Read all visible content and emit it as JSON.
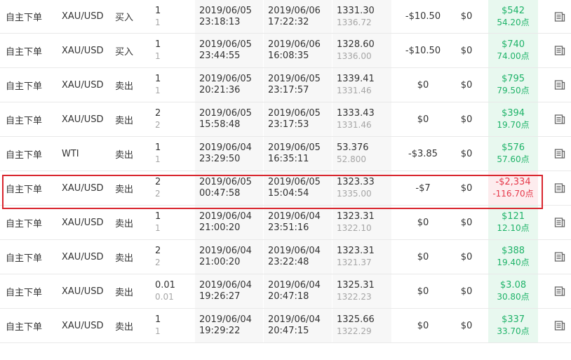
{
  "colors": {
    "profit": "#1fb369",
    "loss": "#e6394b",
    "profit_bg": "#e8f8ef",
    "loss_bg": "#fdecee",
    "highlight_border": "#d9262e"
  },
  "icon_name": "document-detail-icon",
  "rows": [
    {
      "type": "自主下单",
      "symbol": "XAU/USD",
      "direction": "买入",
      "lots": "1",
      "lots_closed": "1",
      "open_date": "2019/06/05",
      "open_time": "23:18:13",
      "close_date": "2019/06/06",
      "close_time": "17:22:32",
      "open_price": "1331.30",
      "close_price": "1336.72",
      "commission": "-$10.50",
      "swap": "$0",
      "profit": "$542",
      "points": "54.20点",
      "loss": false
    },
    {
      "type": "自主下单",
      "symbol": "XAU/USD",
      "direction": "买入",
      "lots": "1",
      "lots_closed": "1",
      "open_date": "2019/06/05",
      "open_time": "23:44:55",
      "close_date": "2019/06/06",
      "close_time": "16:08:35",
      "open_price": "1328.60",
      "close_price": "1336.00",
      "commission": "-$10.50",
      "swap": "$0",
      "profit": "$740",
      "points": "74.00点",
      "loss": false
    },
    {
      "type": "自主下单",
      "symbol": "XAU/USD",
      "direction": "卖出",
      "lots": "1",
      "lots_closed": "1",
      "open_date": "2019/06/05",
      "open_time": "20:21:36",
      "close_date": "2019/06/05",
      "close_time": "23:17:57",
      "open_price": "1339.41",
      "close_price": "1331.46",
      "commission": "$0",
      "swap": "$0",
      "profit": "$795",
      "points": "79.50点",
      "loss": false
    },
    {
      "type": "自主下单",
      "symbol": "XAU/USD",
      "direction": "卖出",
      "lots": "2",
      "lots_closed": "2",
      "open_date": "2019/06/05",
      "open_time": "15:58:48",
      "close_date": "2019/06/05",
      "close_time": "23:17:53",
      "open_price": "1333.43",
      "close_price": "1331.46",
      "commission": "$0",
      "swap": "$0",
      "profit": "$394",
      "points": "19.70点",
      "loss": false
    },
    {
      "type": "自主下单",
      "symbol": "WTI",
      "direction": "卖出",
      "lots": "1",
      "lots_closed": "1",
      "open_date": "2019/06/04",
      "open_time": "23:29:50",
      "close_date": "2019/06/05",
      "close_time": "16:35:11",
      "open_price": "53.376",
      "close_price": "52.800",
      "commission": "-$3.85",
      "swap": "$0",
      "profit": "$576",
      "points": "57.60点",
      "loss": false
    },
    {
      "type": "自主下单",
      "symbol": "XAU/USD",
      "direction": "卖出",
      "lots": "2",
      "lots_closed": "2",
      "open_date": "2019/06/05",
      "open_time": "00:47:58",
      "close_date": "2019/06/05",
      "close_time": "15:04:54",
      "open_price": "1323.33",
      "close_price": "1335.00",
      "commission": "-$7",
      "swap": "$0",
      "profit": "-$2,334",
      "points": "-116.70点",
      "loss": true
    },
    {
      "type": "自主下单",
      "symbol": "XAU/USD",
      "direction": "卖出",
      "lots": "1",
      "lots_closed": "1",
      "open_date": "2019/06/04",
      "open_time": "21:00:20",
      "close_date": "2019/06/04",
      "close_time": "23:51:16",
      "open_price": "1323.31",
      "close_price": "1322.10",
      "commission": "$0",
      "swap": "$0",
      "profit": "$121",
      "points": "12.10点",
      "loss": false
    },
    {
      "type": "自主下单",
      "symbol": "XAU/USD",
      "direction": "卖出",
      "lots": "2",
      "lots_closed": "2",
      "open_date": "2019/06/04",
      "open_time": "21:00:20",
      "close_date": "2019/06/04",
      "close_time": "23:22:48",
      "open_price": "1323.31",
      "close_price": "1321.37",
      "commission": "$0",
      "swap": "$0",
      "profit": "$388",
      "points": "19.40点",
      "loss": false
    },
    {
      "type": "自主下单",
      "symbol": "XAU/USD",
      "direction": "卖出",
      "lots": "0.01",
      "lots_closed": "0.01",
      "open_date": "2019/06/04",
      "open_time": "19:26:27",
      "close_date": "2019/06/04",
      "close_time": "20:47:18",
      "open_price": "1325.31",
      "close_price": "1322.23",
      "commission": "$0",
      "swap": "$0",
      "profit": "$3.08",
      "points": "30.80点",
      "loss": false
    },
    {
      "type": "自主下单",
      "symbol": "XAU/USD",
      "direction": "卖出",
      "lots": "1",
      "lots_closed": "1",
      "open_date": "2019/06/04",
      "open_time": "19:29:22",
      "close_date": "2019/06/04",
      "close_time": "20:47:15",
      "open_price": "1325.66",
      "close_price": "1322.29",
      "commission": "$0",
      "swap": "$0",
      "profit": "$337",
      "points": "33.70点",
      "loss": false
    }
  ]
}
